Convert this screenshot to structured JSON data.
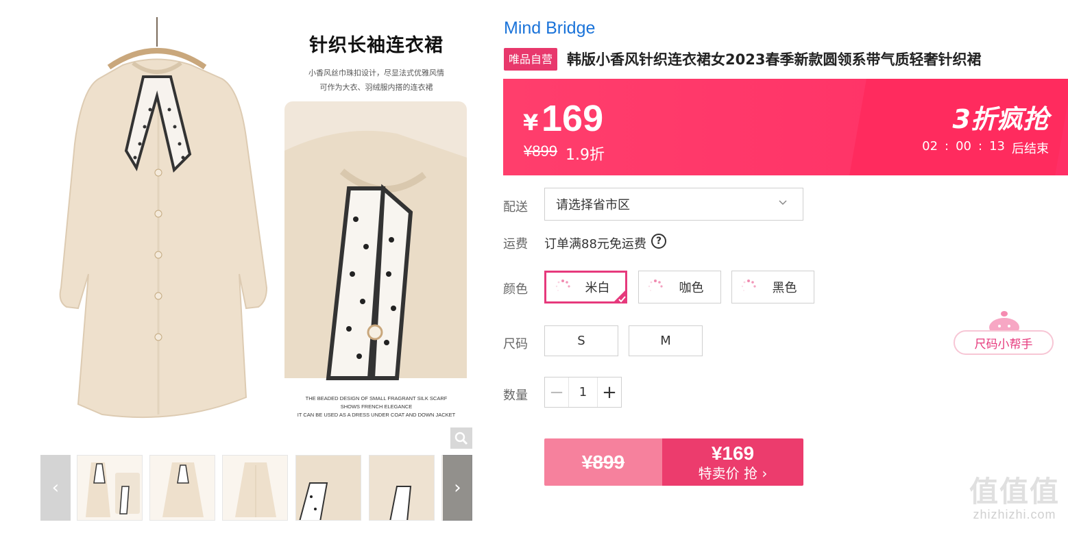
{
  "gallery": {
    "promo_title": "针织长袖连衣裙",
    "promo_desc_line1": "小香风丝巾珠扣设计，尽显法式优雅风情",
    "promo_desc_line2": "可作为大衣、羽绒服内搭的连衣裙",
    "promo_en_line1": "THE BEADED DESIGN OF SMALL FRAGRANT SILK SCARF",
    "promo_en_line2": "SHOWS FRENCH ELEGANCE",
    "promo_en_line3": "IT CAN BE USED AS A DRESS UNDER COAT AND DOWN JACKET",
    "zoom_icon": "magnifier-icon",
    "prev_icon": "chevron-left-icon",
    "next_icon": "chevron-right-icon",
    "thumb_count": 6
  },
  "product": {
    "brand": "Mind Bridge",
    "tag": "唯品自营",
    "title": "韩版小香风针织连衣裙女2023春季新款圆领系带气质轻奢针织裙"
  },
  "price": {
    "currency": "¥",
    "current": "169",
    "original": "¥899",
    "discount": "1.9折",
    "promo_label": "3折疯抢",
    "countdown_h": "02",
    "countdown_m": "00",
    "countdown_s": "13",
    "countdown_sep": ":",
    "countdown_suffix": "后结束"
  },
  "delivery": {
    "label": "配送",
    "placeholder": "请选择省市区"
  },
  "shipping": {
    "label": "运费",
    "text": "订单满88元免运费",
    "help_glyph": "?"
  },
  "colors": {
    "label": "颜色",
    "options": [
      "米白",
      "咖色",
      "黑色"
    ],
    "selected": "米白"
  },
  "sizes": {
    "label": "尺码",
    "options": [
      "S",
      "M"
    ]
  },
  "quantity": {
    "label": "数量",
    "value": "1",
    "minus": "−",
    "plus": "+"
  },
  "buy": {
    "original": "¥899",
    "price": "¥169",
    "label": "特卖价 抢 ›"
  },
  "size_helper": {
    "label": "尺码小帮手"
  },
  "watermark": {
    "logo": "值值值",
    "url": "zhizhizhi.com"
  },
  "colors_theme": {
    "accent": "#e6397c",
    "brand_blue": "#1a73d9",
    "price_band": "#ff3e6c"
  }
}
